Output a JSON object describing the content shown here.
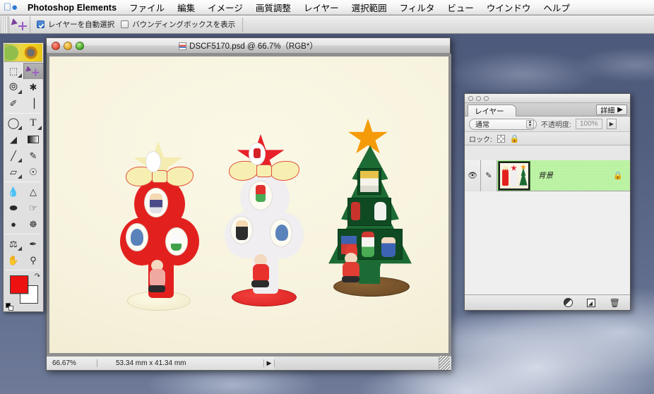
{
  "menubar": {
    "apple_icon": "apple-logo-icon",
    "app_name": "Photoshop Elements",
    "items": [
      {
        "label": "ファイル"
      },
      {
        "label": "編集"
      },
      {
        "label": "イメージ"
      },
      {
        "label": "画質調整"
      },
      {
        "label": "レイヤー"
      },
      {
        "label": "選択範囲"
      },
      {
        "label": "フィルタ"
      },
      {
        "label": "ビュー"
      },
      {
        "label": "ウインドウ"
      },
      {
        "label": "ヘルプ"
      }
    ]
  },
  "options_bar": {
    "tool_icon": "move-tool-icon",
    "auto_select_label": "レイヤーを自動選択",
    "auto_select_checked": true,
    "show_bounding_label": "バウンディングボックスを表示",
    "show_bounding_checked": false
  },
  "toolbox": {
    "banner_icon": "sunflower-banner-image",
    "tools": [
      {
        "name": "marquee-tool",
        "glyph": "⬚",
        "selected": false,
        "has_flyout": true
      },
      {
        "name": "move-tool",
        "glyph": "➤",
        "selected": true,
        "has_flyout": false
      },
      {
        "name": "lasso-tool",
        "glyph": "○",
        "selected": false,
        "has_flyout": true
      },
      {
        "name": "magic-wand-tool",
        "glyph": "✹",
        "selected": false,
        "has_flyout": false
      },
      {
        "name": "selection-brush-tool",
        "glyph": "✐",
        "selected": false,
        "has_flyout": false
      },
      {
        "name": "crop-tool",
        "glyph": "⌗",
        "selected": false,
        "has_flyout": false
      },
      {
        "name": "shape-tool",
        "glyph": "⬭",
        "selected": false,
        "has_flyout": true
      },
      {
        "name": "type-tool",
        "glyph": "T",
        "selected": false,
        "has_flyout": true
      },
      {
        "name": "paint-bucket-tool",
        "glyph": "◢",
        "selected": false,
        "has_flyout": false
      },
      {
        "name": "gradient-tool",
        "glyph": "▤",
        "selected": false,
        "has_flyout": false
      },
      {
        "name": "brush-tool",
        "glyph": "╱",
        "selected": false,
        "has_flyout": true
      },
      {
        "name": "pencil-tool",
        "glyph": "✎",
        "selected": false,
        "has_flyout": false
      },
      {
        "name": "eraser-tool",
        "glyph": "▱",
        "selected": false,
        "has_flyout": true
      },
      {
        "name": "red-eye-tool",
        "glyph": "◉",
        "selected": false,
        "has_flyout": false
      },
      {
        "name": "blur-tool",
        "glyph": "●",
        "selected": false,
        "has_flyout": false
      },
      {
        "name": "sharpen-tool",
        "glyph": "△",
        "selected": false,
        "has_flyout": false
      },
      {
        "name": "sponge-tool",
        "glyph": "⬬",
        "selected": false,
        "has_flyout": false
      },
      {
        "name": "smudge-tool",
        "glyph": "☝",
        "selected": false,
        "has_flyout": false
      },
      {
        "name": "dodge-tool",
        "glyph": "⚲",
        "selected": false,
        "has_flyout": false
      },
      {
        "name": "burn-tool",
        "glyph": "✌",
        "selected": false,
        "has_flyout": false
      },
      {
        "name": "clone-stamp-tool",
        "glyph": "⚓",
        "selected": false,
        "has_flyout": true
      },
      {
        "name": "eyedropper-tool",
        "glyph": "✒",
        "selected": false,
        "has_flyout": false
      },
      {
        "name": "hand-tool",
        "glyph": "✋",
        "selected": false,
        "has_flyout": false
      },
      {
        "name": "zoom-tool",
        "glyph": "⚲",
        "selected": false,
        "has_flyout": false
      }
    ],
    "foreground_color": "#ee1111",
    "background_color": "#ffffff",
    "swap_icon": "swap-colors-icon",
    "default_icon": "default-colors-icon"
  },
  "document": {
    "title": "DSCF5170.psd @ 66.7%（RGB*）",
    "title_icon": "psd-document-icon",
    "close_button": "close-window-button",
    "minimize_button": "minimize-window-button",
    "zoom_button": "zoom-window-button",
    "status": {
      "zoom": "66.67%",
      "dimensions": "53.34 mm x 41.34 mm",
      "arrow_icon": "status-popup-arrow-icon"
    },
    "resize_grip": "window-resize-grip",
    "canvas_artwork": {
      "description": "three wooden christmas tree ornaments on cream background",
      "items": [
        {
          "name": "red-tree-ornament",
          "body_color": "#e41f24",
          "star_color": "#f7eaa8",
          "bow_color": "#f9f0b4",
          "base_color": "#f5f1cf"
        },
        {
          "name": "white-tree-ornament",
          "body_color": "#f2f0f2",
          "star_color": "#e8202a",
          "bow_color": "#f9f0b4",
          "base_color": "#ea2a2a"
        },
        {
          "name": "green-tree-ornament",
          "body_color": "#1f6b35",
          "star_color": "#f59b0a",
          "bow_color": "",
          "base_color": "#6b4a28"
        }
      ]
    }
  },
  "layers_palette": {
    "window_dots": [
      "close-dot",
      "minimize-dot",
      "zoom-dot"
    ],
    "tab_label": "レイヤー",
    "more_button_label": "詳細",
    "more_button_arrow": "▶",
    "blend_mode": "通常",
    "opacity_label": "不透明度:",
    "opacity_value": "100%",
    "opacity_arrow": "▶",
    "lock_label": "ロック:",
    "lock_transparency_icon": "lock-transparency-checker-icon",
    "lock_all_icon": "lock-all-padlock-icon",
    "layers": [
      {
        "visible_icon": "eye-icon",
        "link_icon": "paintbrush-icon",
        "thumbnail": "christmas-trees-thumbnail",
        "name": "背景",
        "locked_icon": "padlock-icon",
        "selected": true,
        "highlight_color": "#b9f2a0"
      }
    ],
    "bottom_buttons": [
      {
        "name": "new-adjustment-layer-button",
        "icon": "half-filled-circle-icon"
      },
      {
        "name": "new-layer-button",
        "icon": "new-layer-icon"
      },
      {
        "name": "delete-layer-button",
        "icon": "trash-icon",
        "glyph": "🗑"
      }
    ]
  }
}
